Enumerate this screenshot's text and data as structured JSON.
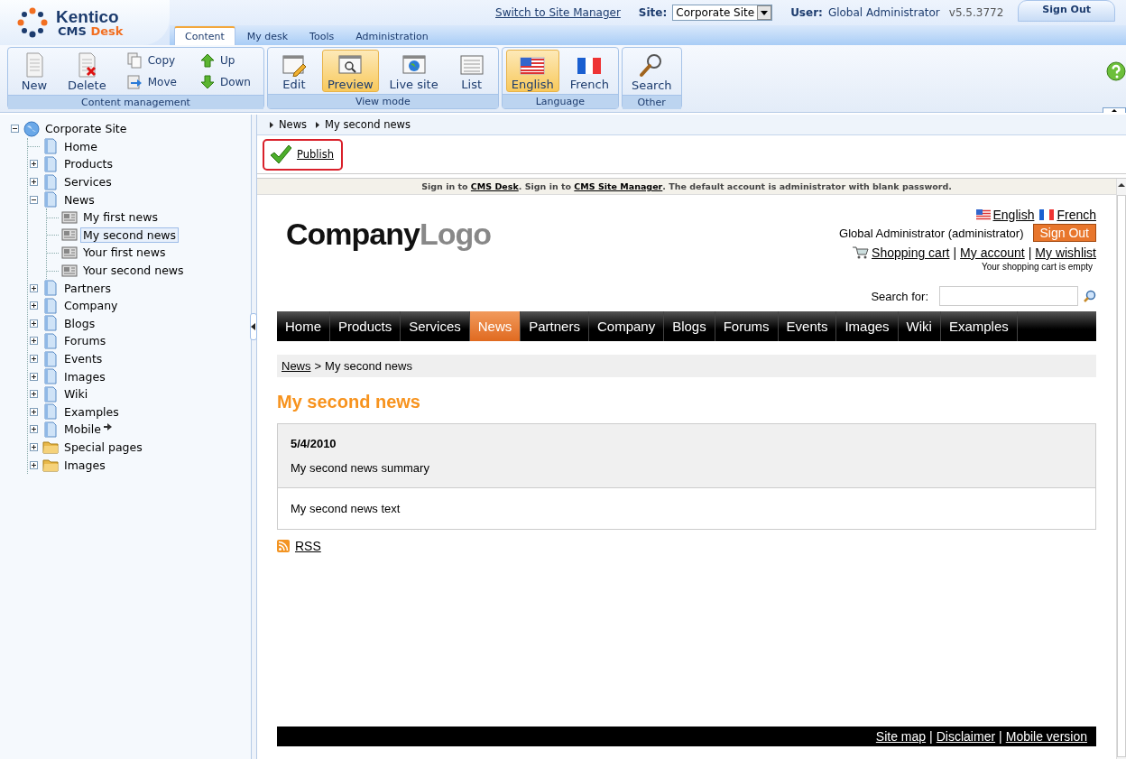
{
  "app": {
    "brand": "Kentico",
    "product": "CMS",
    "product_accent": "Desk"
  },
  "header": {
    "switch_link": "Switch to Site Manager",
    "site_label": "Site:",
    "site_value": "Corporate Site",
    "user_label": "User:",
    "user_name": "Global Administrator",
    "version": "v5.5.3772",
    "sign_out": "Sign Out"
  },
  "tabs": [
    {
      "label": "Content",
      "selected": true
    },
    {
      "label": "My desk",
      "selected": false
    },
    {
      "label": "Tools",
      "selected": false
    },
    {
      "label": "Administration",
      "selected": false
    }
  ],
  "toolbar_groups": [
    {
      "title": "Content management",
      "buttons": [
        {
          "label": "New",
          "kind": "large"
        },
        {
          "label": "Delete",
          "kind": "large"
        },
        {
          "label": "Copy",
          "kind": "small"
        },
        {
          "label": "Move",
          "kind": "small"
        },
        {
          "label": "Up",
          "kind": "small"
        },
        {
          "label": "Down",
          "kind": "small"
        }
      ]
    },
    {
      "title": "View mode",
      "buttons": [
        {
          "label": "Edit",
          "kind": "large",
          "selected": false
        },
        {
          "label": "Preview",
          "kind": "large",
          "selected": true
        },
        {
          "label": "Live site",
          "kind": "large",
          "selected": false
        },
        {
          "label": "List",
          "kind": "large",
          "selected": false
        }
      ]
    },
    {
      "title": "Language",
      "buttons": [
        {
          "label": "English",
          "kind": "large",
          "selected": true
        },
        {
          "label": "French",
          "kind": "large",
          "selected": false
        }
      ]
    },
    {
      "title": "Other",
      "buttons": [
        {
          "label": "Search",
          "kind": "large"
        }
      ]
    }
  ],
  "tree": [
    {
      "label": "Corporate Site",
      "kind": "site",
      "expanded": true,
      "selected": false,
      "children": [
        {
          "label": "Home",
          "kind": "page",
          "selected": false
        },
        {
          "label": "Products",
          "kind": "page",
          "expanded": false,
          "selected": false
        },
        {
          "label": "Services",
          "kind": "page",
          "expanded": false,
          "selected": false
        },
        {
          "label": "News",
          "kind": "page",
          "expanded": true,
          "selected": false,
          "children": [
            {
              "label": "My first news",
              "kind": "news",
              "selected": false
            },
            {
              "label": "My second news",
              "kind": "news",
              "selected": true
            },
            {
              "label": "Your first news",
              "kind": "news",
              "selected": false
            },
            {
              "label": "Your second news",
              "kind": "news",
              "selected": false
            }
          ]
        },
        {
          "label": "Partners",
          "kind": "page",
          "expanded": false,
          "selected": false
        },
        {
          "label": "Company",
          "kind": "page",
          "expanded": false,
          "selected": false
        },
        {
          "label": "Blogs",
          "kind": "page",
          "expanded": false,
          "selected": false
        },
        {
          "label": "Forums",
          "kind": "page",
          "expanded": false,
          "selected": false
        },
        {
          "label": "Events",
          "kind": "page",
          "expanded": false,
          "selected": false
        },
        {
          "label": "Images",
          "kind": "page",
          "expanded": false,
          "selected": false
        },
        {
          "label": "Wiki",
          "kind": "page",
          "expanded": false,
          "selected": false
        },
        {
          "label": "Examples",
          "kind": "page",
          "expanded": false,
          "selected": false
        },
        {
          "label": "Mobile",
          "kind": "page",
          "expanded": false,
          "selected": false,
          "linked": true
        },
        {
          "label": "Special pages",
          "kind": "folder",
          "expanded": false,
          "selected": false
        },
        {
          "label": "Images",
          "kind": "folder",
          "expanded": false,
          "selected": false
        }
      ]
    }
  ],
  "path": [
    "News",
    "My second news"
  ],
  "action": {
    "label": "Publish"
  },
  "preview": {
    "notice": "Sign in to **CMS Desk**. Sign in to **CMS Site Manager**. The default account is administrator with blank password.",
    "logo": {
      "dark": "Company",
      "light": "Logo"
    },
    "languages": [
      "English",
      "French"
    ],
    "user_line": "Global Administrator (administrator)",
    "sign_out": "Sign Out",
    "links": [
      "Shopping cart",
      "My account",
      "My wishlist"
    ],
    "link_separator": "|",
    "cart_status": "Your shopping cart is empty",
    "search_label": "Search for:",
    "menu": [
      {
        "label": "Home",
        "selected": false
      },
      {
        "label": "Products",
        "selected": false
      },
      {
        "label": "Services",
        "selected": false
      },
      {
        "label": "News",
        "selected": true
      },
      {
        "label": "Partners",
        "selected": false
      },
      {
        "label": "Company",
        "selected": false
      },
      {
        "label": "Blogs",
        "selected": false
      },
      {
        "label": "Forums",
        "selected": false
      },
      {
        "label": "Events",
        "selected": false
      },
      {
        "label": "Images",
        "selected": false
      },
      {
        "label": "Wiki",
        "selected": false
      },
      {
        "label": "Examples",
        "selected": false
      }
    ],
    "breadcrumb": [
      {
        "label": "News",
        "link": true
      },
      {
        "label": "My second news",
        "link": false
      }
    ],
    "breadcrumb_separator": ">",
    "title": "My second news",
    "date": "5/4/2010",
    "summary": "My second news summary",
    "text": "My second news text",
    "rss": "RSS",
    "footer_links": [
      "Site map",
      "Disclaimer",
      "Mobile version"
    ]
  }
}
